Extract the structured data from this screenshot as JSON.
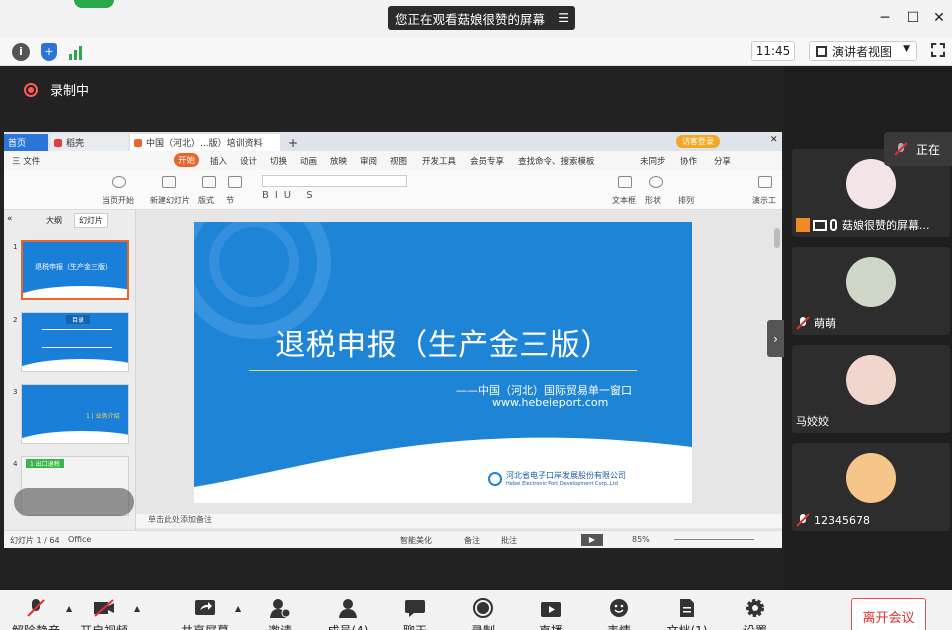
{
  "top": {
    "viewing_text": "您正在观看菇娘很赞的屏幕"
  },
  "toolbar": {
    "time": "11:45",
    "view_mode": "演讲者视图"
  },
  "recording": {
    "label": "录制中"
  },
  "wps": {
    "tabs": [
      "首页",
      "稻壳",
      "中国（河北）...版）培训资料"
    ],
    "login": "访客登录",
    "menu": [
      "三 文件",
      "开始",
      "插入",
      "设计",
      "切换",
      "动画",
      "放映",
      "审阅",
      "视图",
      "开发工具",
      "会员专享",
      "查找命令、搜索模板",
      "未同步",
      "协作",
      "分享"
    ],
    "ribbon": [
      "当页开始",
      "新建幻灯片",
      "版式",
      "节",
      "文本框",
      "形状",
      "排列",
      "演示工"
    ],
    "pane_tabs": [
      "大纲",
      "幻灯片"
    ],
    "thumbs": [
      {
        "num": "1",
        "title": "退税申报（生产金三版）"
      },
      {
        "num": "2",
        "title": "目录"
      },
      {
        "num": "3",
        "title": "1 | 业务介绍"
      },
      {
        "num": "4",
        "title": "1 出口退税"
      }
    ],
    "slide": {
      "title": "退税申报（生产金三版）",
      "sub1": "——中国（河北）国际贸易单一窗口",
      "sub2": "www.hebeieport.com",
      "logo_cn": "河北省电子口岸发展股份有限公司",
      "logo_en": "Hebei Electronic Port Development Corp.,Ltd"
    },
    "notes": "单击此处添加备注",
    "status": {
      "slide_count": "幻灯片 1 / 64",
      "theme": "Office",
      "smart_beautify": "智能美化",
      "remark": "备注",
      "comment": "批注",
      "zoom": "85%"
    }
  },
  "participants": [
    {
      "name": "菇娘很赞的屏幕...",
      "muted": false,
      "color": "#f3e4e8"
    },
    {
      "name": "萌萌",
      "muted": true,
      "color": "#cfd8c8"
    },
    {
      "name": "马姣姣",
      "muted": false,
      "color": "#f0d6cc"
    },
    {
      "name": "12345678",
      "muted": true,
      "color": "#f5c58a"
    }
  ],
  "talking": {
    "label": "正在"
  },
  "bottom": {
    "buttons": [
      "解除静音",
      "开启视频",
      "共享屏幕",
      "邀请",
      "成员(4)",
      "聊天",
      "录制",
      "直播",
      "表情",
      "文档(1)",
      "设置"
    ],
    "leave": "离开会议"
  },
  "colors": {
    "slide_blue": "#1e84d6",
    "leave_red": "#e03030"
  }
}
